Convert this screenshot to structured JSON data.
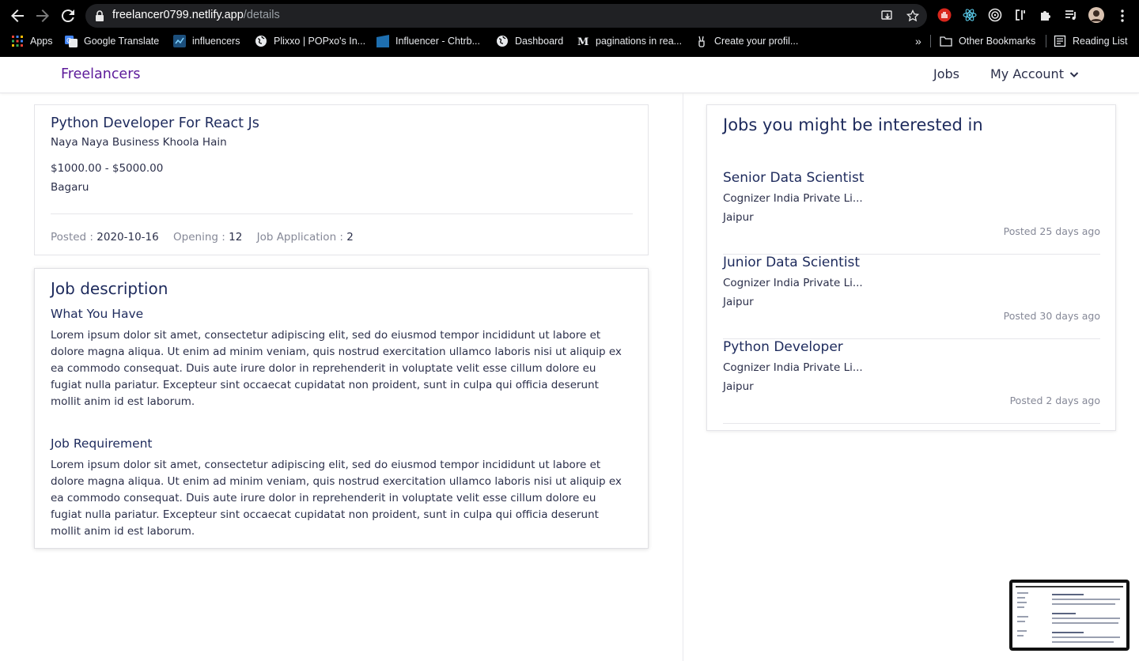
{
  "browser": {
    "url_host": "freelancer0799.netlify.app",
    "url_path": "/details",
    "bookmarks": [
      {
        "label": "Apps",
        "icon": "apps-grid-icon"
      },
      {
        "label": "Google Translate",
        "icon": "google-translate-icon"
      },
      {
        "label": "influencers",
        "icon": "influencers-icon"
      },
      {
        "label": "Plixxo | POPxo's In...",
        "icon": "globe-icon"
      },
      {
        "label": "Influencer - Chtrb...",
        "icon": "chtrbox-icon"
      },
      {
        "label": "Dashboard",
        "icon": "globe-icon"
      },
      {
        "label": "paginations in rea...",
        "icon": "medium-icon"
      },
      {
        "label": "Create your profil...",
        "icon": "peace-hand-icon"
      }
    ],
    "overflow_label": "»",
    "other_bookmarks": "Other Bookmarks",
    "reading_list": "Reading List"
  },
  "header": {
    "brand": "Freelancers",
    "nav_jobs": "Jobs",
    "nav_account": "My Account"
  },
  "job": {
    "title": "Python Developer For React Js",
    "company": "Naya Naya Business Khoola Hain",
    "salary": "$1000.00 - $5000.00",
    "location": "Bagaru",
    "posted_label": "Posted :",
    "posted_value": "2020-10-16",
    "opening_label": "Opening :",
    "opening_value": "12",
    "applications_label": "Job Application :",
    "applications_value": "2"
  },
  "description": {
    "heading": "Job description",
    "have_heading": "What You Have",
    "have_text": "Lorem ipsum dolor sit amet, consectetur adipiscing elit, sed do eiusmod tempor incididunt ut labore et dolore magna aliqua. Ut enim ad minim veniam, quis nostrud exercitation ullamco laboris nisi ut aliquip ex ea commodo consequat. Duis aute irure dolor in reprehenderit in voluptate velit esse cillum dolore eu fugiat nulla pariatur. Excepteur sint occaecat cupidatat non proident, sunt in culpa qui officia deserunt mollit anim id est laborum.",
    "req_heading": "Job Requirement",
    "req_text": "Lorem ipsum dolor sit amet, consectetur adipiscing elit, sed do eiusmod tempor incididunt ut labore et dolore magna aliqua. Ut enim ad minim veniam, quis nostrud exercitation ullamco laboris nisi ut aliquip ex ea commodo consequat. Duis aute irure dolor in reprehenderit in voluptate velit esse cillum dolore eu fugiat nulla pariatur. Excepteur sint occaecat cupidatat non proident, sunt in culpa qui officia deserunt mollit anim id est laborum."
  },
  "sidebar": {
    "heading": "Jobs you might be interested in",
    "jobs": [
      {
        "title": "Senior Data Scientist",
        "company": "Cognizer India Private Li...",
        "location": "Jaipur",
        "posted": "Posted 25 days ago"
      },
      {
        "title": "Junior Data Scientist",
        "company": "Cognizer India Private Li...",
        "location": "Jaipur",
        "posted": "Posted 30 days ago"
      },
      {
        "title": "Python Developer",
        "company": "Cognizer India Private Li...",
        "location": "Jaipur",
        "posted": "Posted 2 days ago"
      }
    ]
  },
  "colors": {
    "brand": "#5c1a9a",
    "heading": "#1d2a5c",
    "text": "#2b2f4a",
    "muted": "#858897"
  }
}
